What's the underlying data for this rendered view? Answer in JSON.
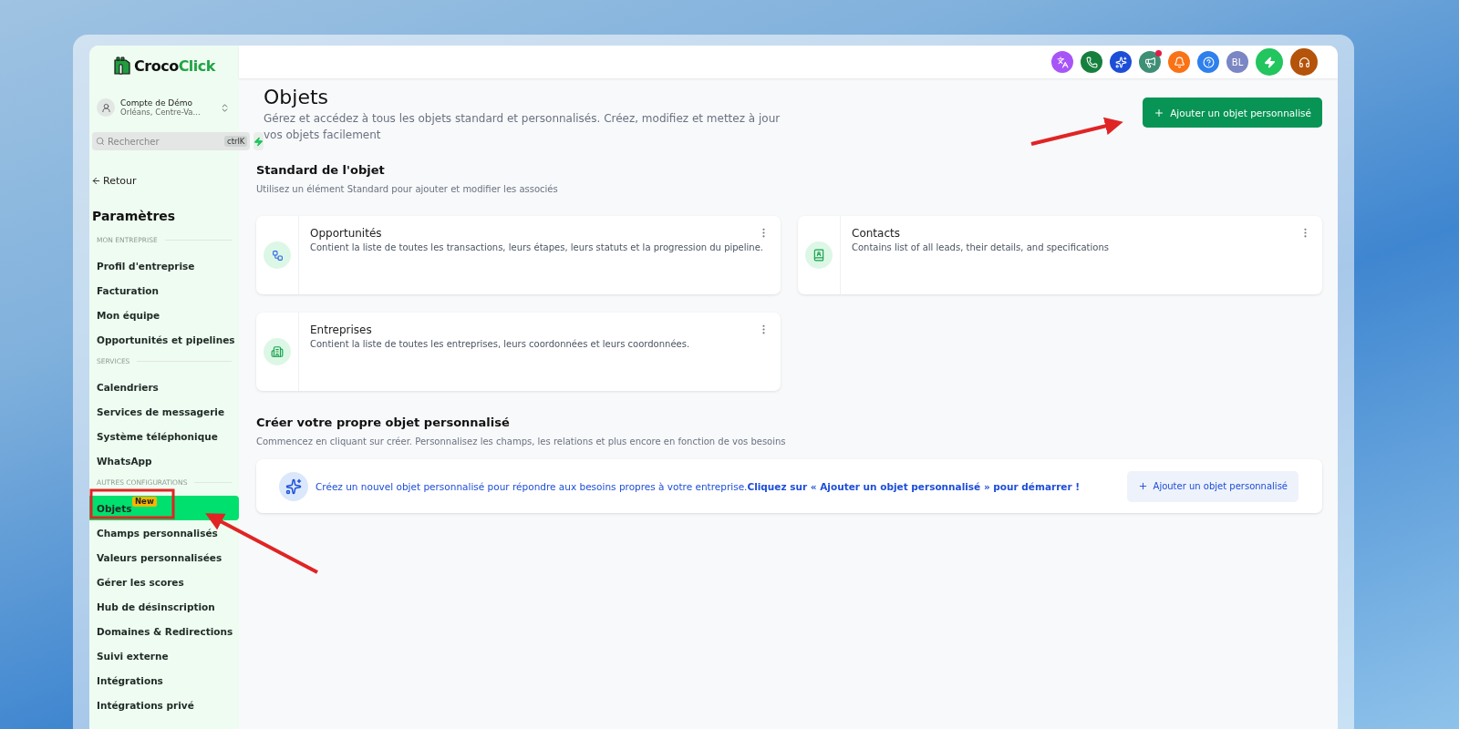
{
  "brand": {
    "name_start": "Croco",
    "name_end": "Click"
  },
  "account": {
    "name": "Compte de Démo",
    "location": "Orléans, Centre-Va..."
  },
  "search": {
    "placeholder": "Rechercher",
    "shortcut": "ctrlK"
  },
  "back_link": "Retour",
  "sidebar": {
    "title": "Paramètres",
    "sections": [
      {
        "heading": "MON ENTREPRISE",
        "items": [
          {
            "label": "Profil d'entreprise",
            "selected": false
          },
          {
            "label": "Facturation",
            "selected": false
          },
          {
            "label": "Mon équipe",
            "selected": false
          },
          {
            "label": "Opportunités et pipelines",
            "selected": false
          }
        ]
      },
      {
        "heading": "SERVICES",
        "items": [
          {
            "label": "Calendriers",
            "selected": false
          },
          {
            "label": "Services de messagerie",
            "selected": false
          },
          {
            "label": "Système téléphonique",
            "selected": false
          },
          {
            "label": "WhatsApp",
            "selected": false
          }
        ]
      },
      {
        "heading": "AUTRES CONFIGURATIONS",
        "items": [
          {
            "label": "Objets",
            "selected": true,
            "badge": "New"
          },
          {
            "label": "Champs personnalisés",
            "selected": false
          },
          {
            "label": "Valeurs personnalisées",
            "selected": false
          },
          {
            "label": "Gérer les scores",
            "selected": false
          },
          {
            "label": "Hub de désinscription",
            "selected": false
          },
          {
            "label": "Domaines & Redirections",
            "selected": false
          },
          {
            "label": "Suivi externe",
            "selected": false
          },
          {
            "label": "Intégrations",
            "selected": false
          },
          {
            "label": "Intégrations privé",
            "selected": false
          }
        ]
      }
    ]
  },
  "topbar": {
    "icons": [
      {
        "kind": "translate",
        "color": "#a855f7"
      },
      {
        "kind": "phone",
        "color": "#15803d"
      },
      {
        "kind": "sparkle",
        "color": "#1d4ed8"
      },
      {
        "kind": "megaphone",
        "color": "#3f8f76",
        "badge": true
      },
      {
        "kind": "bell",
        "color": "#f97316"
      },
      {
        "kind": "help",
        "color": "#2f80ed"
      },
      {
        "kind": "avatar",
        "color": "#7b86c4",
        "initials": "BL"
      },
      {
        "kind": "bolt",
        "color": "#22c55e"
      },
      {
        "kind": "headset",
        "color": "#b45309"
      }
    ]
  },
  "page": {
    "title": "Objets",
    "description": "Gérez et accédez à tous les objets standard et personnalisés. Créez, modifiez et mettez à jour vos objets facilement",
    "add_button": "Ajouter un objet personnalisé"
  },
  "standard": {
    "title": "Standard de l'objet",
    "subtitle": "Utilisez un élément Standard pour ajouter et modifier les associés",
    "cards": [
      {
        "kind": "pipeline",
        "title": "Opportunités",
        "description": "Contient la liste de toutes les transactions, leurs étapes, leurs statuts et la progression du pipeline."
      },
      {
        "kind": "contacts",
        "title": "Contacts",
        "description": "Contains list of all leads, their details, and specifications"
      },
      {
        "kind": "companies",
        "title": "Entreprises",
        "description": "Contient la liste de toutes les entreprises, leurs coordonnées et leurs coordonnées."
      }
    ]
  },
  "custom": {
    "title": "Créer votre propre objet personnalisé",
    "subtitle": "Commencez en cliquant sur créer. Personnalisez les champs, les relations et plus encore en fonction de vos besoins",
    "banner_text": "Créez un nouvel objet personnalisé pour répondre aux besoins propres à votre entreprise.**Cliquez sur « Ajouter un objet personnalisé » pour démarrer !**",
    "banner_button": "Ajouter un objet personnalisé"
  }
}
